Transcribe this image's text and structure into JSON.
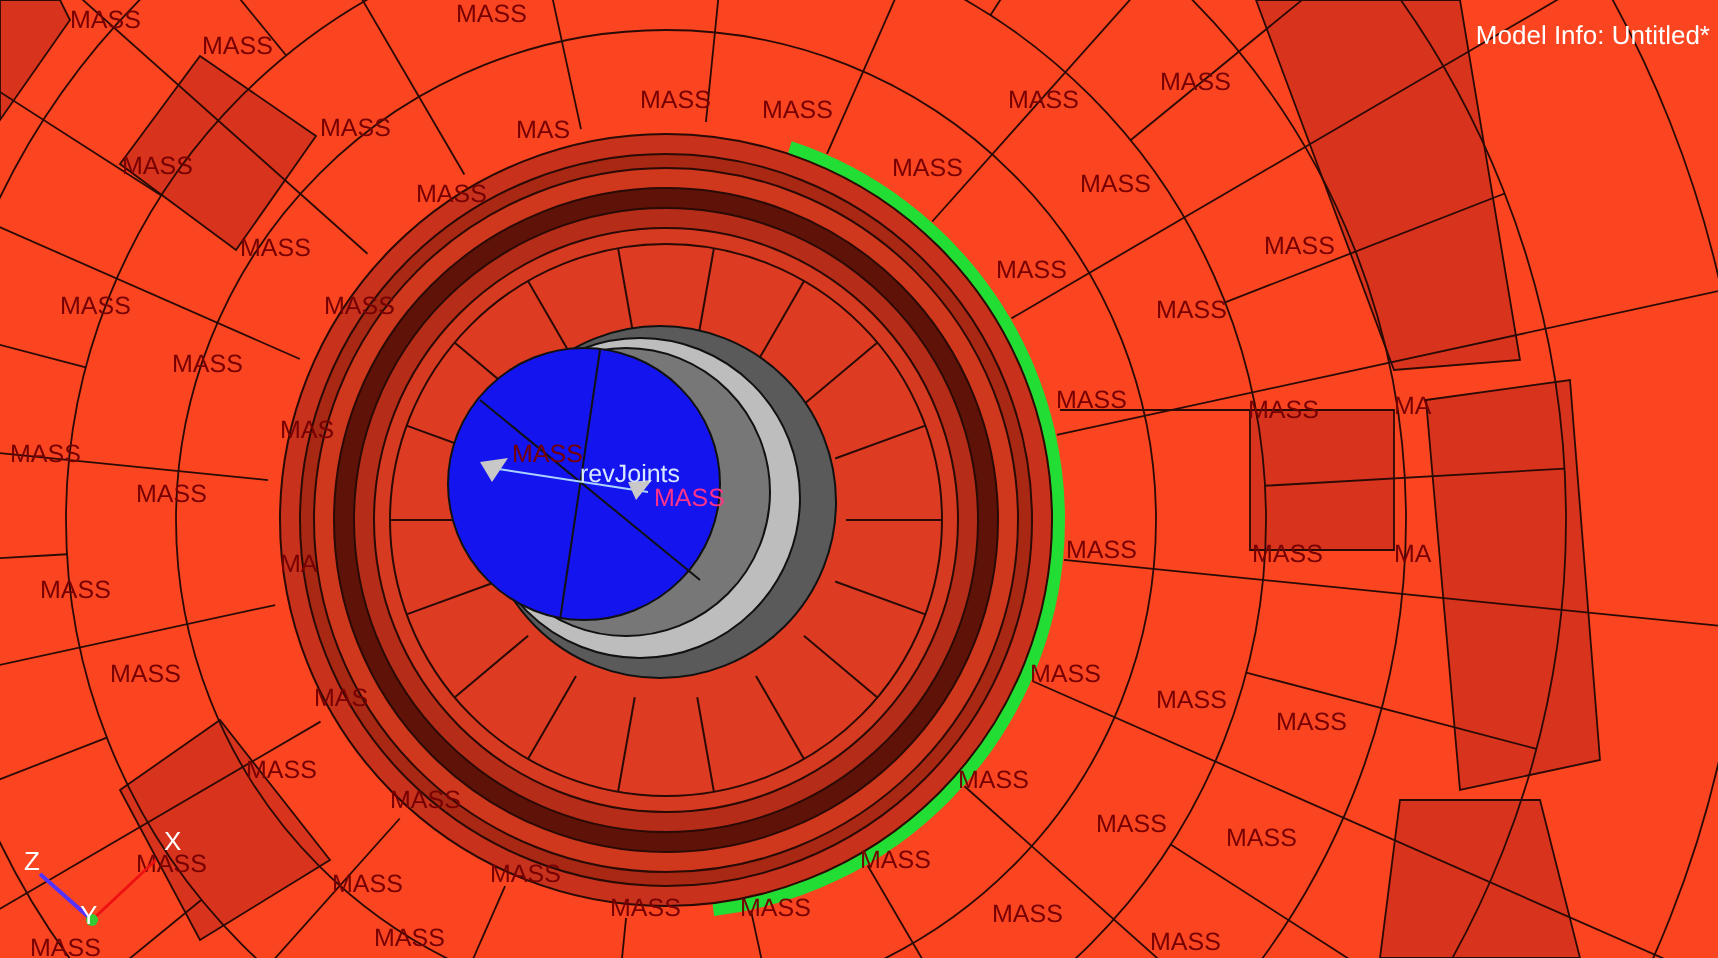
{
  "viewport": {
    "model_info": "Model Info: Untitled*",
    "joint_label": "revJoints",
    "axes": [
      {
        "label": "Z"
      },
      {
        "label": "X"
      },
      {
        "label": "Y"
      }
    ],
    "mass_labels": [
      "MASS",
      "MASS",
      "MASS",
      "MASS",
      "MASS",
      "MASS",
      "MASS",
      "MASS",
      "MAS",
      "MASS",
      "MASS",
      "MASS",
      "MASS",
      "MASS",
      "MASS",
      "MASS",
      "MASS",
      "MASS",
      "MASS",
      "MASS",
      "MASS",
      "MASS",
      "MA",
      "MAS",
      "MASS",
      "MASS",
      "MASS",
      "MASS",
      "MASS",
      "MASS",
      "MA",
      "MA",
      "MASS",
      "MASS",
      "MASS",
      "MAS",
      "MASS",
      "MASS",
      "MASS",
      "MASS",
      "MASS",
      "MASS",
      "MASS",
      "MASS",
      "MASS",
      "MASS",
      "MASS",
      "MASS",
      "MASS",
      "MASS",
      "MASS",
      "MASS",
      "MASS"
    ]
  }
}
